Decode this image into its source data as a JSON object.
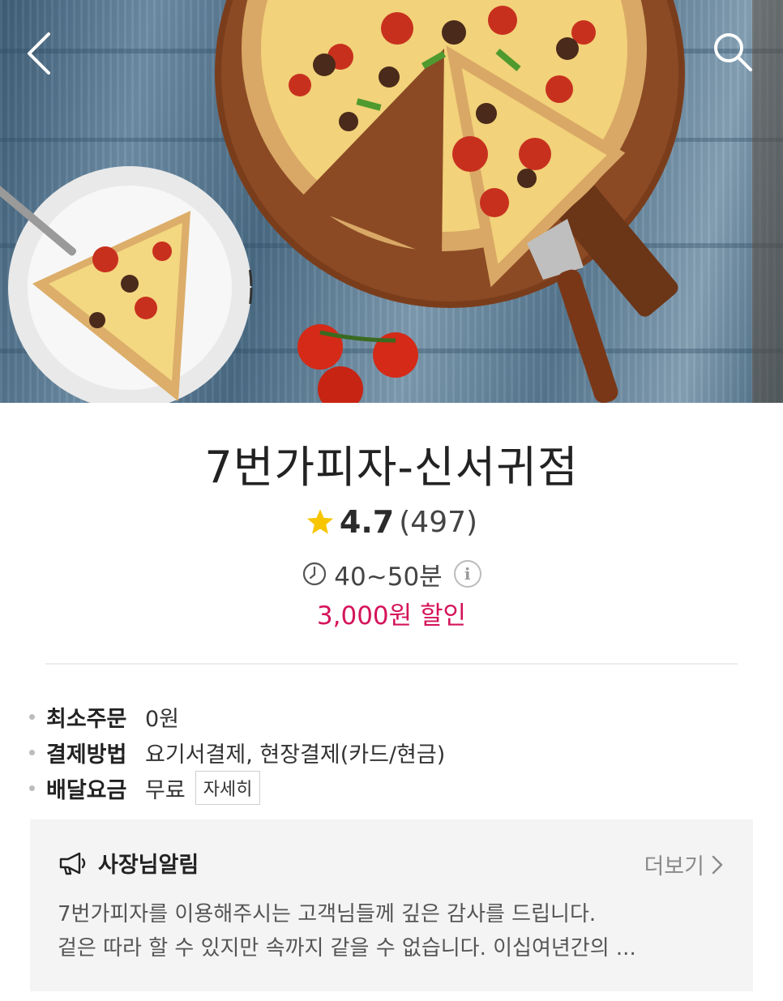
{
  "hero": {
    "back_icon": "chevron-left-icon",
    "search_icon": "search-icon"
  },
  "store": {
    "name": "7번가피자-신서귀점",
    "rating": "4.7",
    "review_count": "(497)",
    "rating_star_color": "#f7c600",
    "delivery_time": "40~50분",
    "discount": "3,000원 할인",
    "discount_color": "#d4145a"
  },
  "info": {
    "min_order_label": "최소주문",
    "min_order_value": "0원",
    "payment_label": "결제방법",
    "payment_value": "요기서결제, 현장결제(카드/현금)",
    "delivery_fee_label": "배달요금",
    "delivery_fee_value": "무료",
    "detail_button": "자세히"
  },
  "notice": {
    "icon": "megaphone-icon",
    "title": "사장님알림",
    "more_label": "더보기",
    "line1": "7번가피자를 이용해주시는 고객님들께 깊은 감사를 드립니다.",
    "line2": " 겉은 따라 할 수 있지만 속까지 같을 수 없습니다. 이십여년간의 ..."
  }
}
